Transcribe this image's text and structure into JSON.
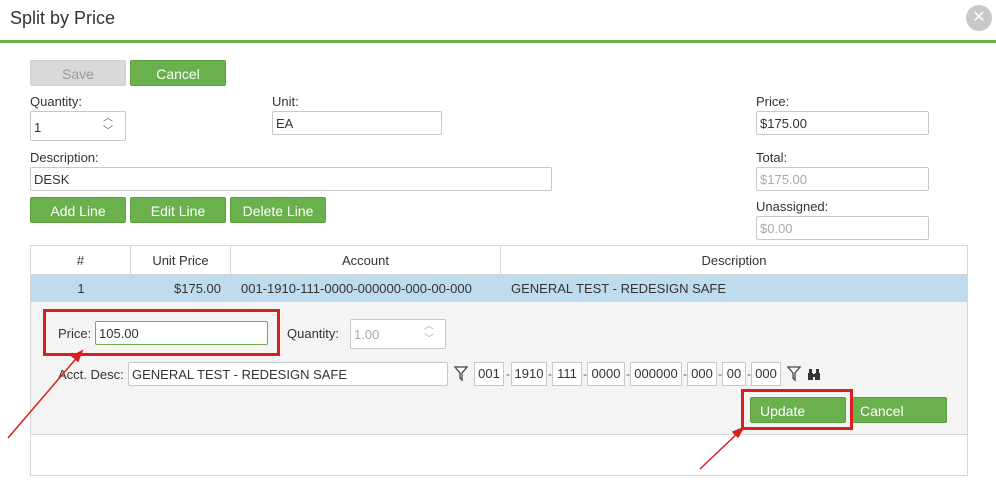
{
  "window": {
    "title": "Split by Price",
    "close_glyph": "✕"
  },
  "toolbar": {
    "save_label": "Save",
    "cancel_label": "Cancel"
  },
  "form": {
    "quantity_label": "Quantity:",
    "quantity_value": "1",
    "unit_label": "Unit:",
    "unit_value": "EA",
    "price_label": "Price:",
    "price_value": "$175.00",
    "description_label": "Description:",
    "description_value": "DESK",
    "total_label": "Total:",
    "total_value": "$175.00",
    "unassigned_label": "Unassigned:",
    "unassigned_value": "$0.00"
  },
  "line_buttons": {
    "add": "Add Line",
    "edit": "Edit Line",
    "delete": "Delete Line"
  },
  "grid": {
    "columns": [
      "#",
      "Unit Price",
      "Account",
      "Description"
    ],
    "rows": [
      {
        "num": "1",
        "unit_price": "$175.00",
        "account": "001-1910-111-0000-000000-000-00-000",
        "description": "GENERAL TEST - REDESIGN SAFE"
      }
    ]
  },
  "edit": {
    "price_label": "Price:",
    "price_value": "105.00",
    "quantity_label": "Quantity:",
    "quantity_value": "1.00",
    "acct_desc_label": "Acct. Desc:",
    "acct_desc_value": "GENERAL TEST - REDESIGN SAFE",
    "account_segments": [
      "001",
      "1910",
      "111",
      "0000",
      "000000",
      "000",
      "00",
      "000"
    ],
    "update_label": "Update",
    "cancel_label": "Cancel"
  },
  "icons": {
    "filter": "filter-icon",
    "lookup": "binoculars-icon"
  },
  "colors": {
    "accent": "#6ab04c",
    "highlight": "#d92020",
    "row_selected": "#bfdcee"
  }
}
